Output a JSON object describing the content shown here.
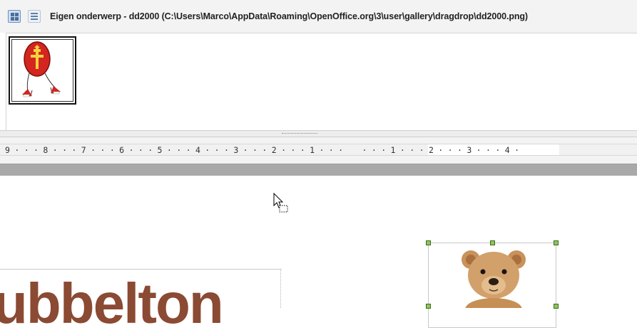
{
  "gallery": {
    "title": "Eigen onderwerp - dd2000 (C:\\Users\\Marco\\AppData\\Roaming\\OpenOffice.org\\3\\user\\gallery\\dragdrop\\dd2000.png)",
    "view_buttons": [
      "icon-view-icon",
      "detail-view-icon"
    ],
    "thumbnail": "sinterklaas-mitre-clipart"
  },
  "ruler": {
    "text": "9 · · · 8 · · · 7 · · · 6 · · · 5 · · · 4 · · · 3 · · · 2 · · · 1 · · ·    · · · 1 · · · 2 · · · 3 · · · 4 ·"
  },
  "document": {
    "word": "ubbelton",
    "image": "teddy-bear-photo"
  },
  "colors": {
    "text_accent": "#8b4a33",
    "handle": "#8dc55e"
  }
}
